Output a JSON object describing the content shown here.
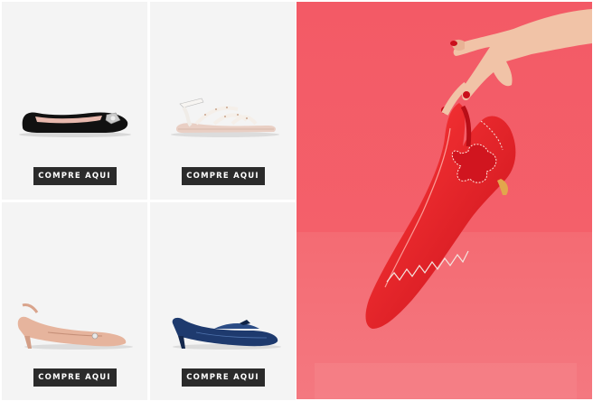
{
  "products": [
    {
      "cta": "COMPRE AQUI",
      "icon": "black-ballerina-flat"
    },
    {
      "cta": "COMPRE AQUI",
      "icon": "white-strappy-sandal"
    },
    {
      "cta": "COMPRE AQUI",
      "icon": "nude-slingback-kitten-heel"
    },
    {
      "cta": "COMPRE AQUI",
      "icon": "navy-patent-mule"
    }
  ],
  "hero": {
    "icon": "hand-holding-red-slingback-photo"
  },
  "colors": {
    "cta_bg": "#2b2b2b",
    "cell_bg": "#f4f4f4",
    "hero_bg": "#f25c66",
    "shoe_red": "#d8161f"
  }
}
